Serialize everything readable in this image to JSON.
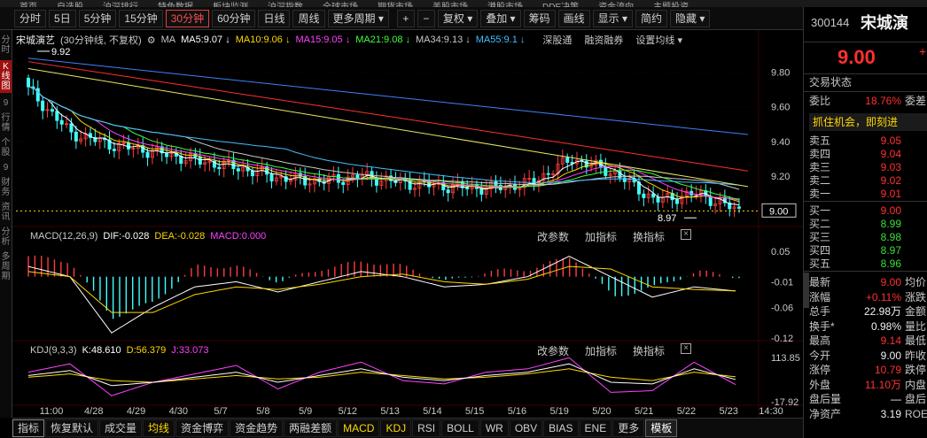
{
  "market_tabs": [
    "首页",
    "自选股",
    "沪深排行",
    "特色数据",
    "板块监测",
    "沪深指数",
    "全球市场",
    "期货市场",
    "美股市场",
    "港股市场",
    "DDE决策",
    "资金流向",
    "主题投资"
  ],
  "toolbar": {
    "periods": [
      "分时",
      "5日",
      "5分钟",
      "15分钟",
      "30分钟",
      "60分钟",
      "日线",
      "周线",
      "更多周期 ▾"
    ],
    "active_period": "30分钟",
    "zoom_in": "+",
    "zoom_out": "−",
    "tools": [
      "复权 ▾",
      "叠加 ▾",
      "筹码",
      "画线",
      "显示 ▾",
      "简约",
      "隐藏 ▾"
    ]
  },
  "left_strip": [
    "分时",
    "K线图",
    "9",
    "行情",
    "个股",
    "9",
    "财务",
    "资讯",
    "分析",
    "多周期"
  ],
  "main_panel": {
    "stock_name": "宋城演艺",
    "period_label": "(30分钟线, 不复权)",
    "ma_label": "MA",
    "ma": [
      {
        "label": "MA5:9.07",
        "color": "#ffffff"
      },
      {
        "label": "MA10:9.06",
        "color": "#ffd700"
      },
      {
        "label": "MA15:9.05",
        "color": "#ff40ff"
      },
      {
        "label": "MA21:9.08",
        "color": "#40ff40"
      },
      {
        "label": "MA34:9.13",
        "color": "#c8c8c8"
      },
      {
        "label": "MA55:9.1",
        "color": "#40c0ff"
      }
    ],
    "extra_tabs": [
      "深股通",
      "融资融券",
      "设置均线 ▾"
    ],
    "y_ticks": [
      "9.80",
      "9.60",
      "9.40",
      "9.20",
      "9.00"
    ],
    "high_label": "9.92",
    "low_label": "8.97",
    "current_price_tag": "9.00"
  },
  "macd_panel": {
    "title": "MACD(12,26,9)",
    "dif": "DIF:-0.028",
    "dea": "DEA:-0.028",
    "macd": "MACD:0.000",
    "tools": [
      "改参数",
      "加指标",
      "换指标"
    ],
    "y_ticks": [
      "0.05",
      "-0.01",
      "-0.06",
      "-0.12"
    ]
  },
  "kdj_panel": {
    "title": "KDJ(9,3,3)",
    "k": "K:48.610",
    "d": "D:56.379",
    "j": "J:33.073",
    "tools": [
      "改参数",
      "加指标",
      "换指标"
    ],
    "y_ticks": [
      "113.85",
      "-17.92"
    ]
  },
  "x_axis": [
    "11:00",
    "4/28",
    "4/29",
    "4/30",
    "5/7",
    "5/8",
    "5/9",
    "5/12",
    "5/13",
    "5/14",
    "5/15",
    "5/16",
    "5/19",
    "5/20",
    "5/21",
    "5/22",
    "5/23",
    "14:30"
  ],
  "bottom_tabs": [
    "指标",
    "恢复默认",
    "成交量",
    "均线",
    "资金博弈",
    "资金趋势",
    "两融差额",
    "MACD",
    "KDJ",
    "RSI",
    "BOLL",
    "WR",
    "OBV",
    "BIAS",
    "ENE",
    "更多",
    "模板"
  ],
  "right_panel": {
    "code": "300144",
    "name": "宋城演",
    "price": "9.00",
    "trade_status_label": "交易状态",
    "wei_bi_label": "委比",
    "wei_bi_value": "18.76%",
    "wei_cha_label": "委差",
    "banner": "抓住机会，即刻进",
    "asks": [
      {
        "label": "卖五",
        "price": "9.05"
      },
      {
        "label": "卖四",
        "price": "9.04"
      },
      {
        "label": "卖三",
        "price": "9.03"
      },
      {
        "label": "卖二",
        "price": "9.02"
      },
      {
        "label": "卖一",
        "price": "9.01"
      }
    ],
    "bids": [
      {
        "label": "买一",
        "price": "9.00"
      },
      {
        "label": "买二",
        "price": "8.99"
      },
      {
        "label": "买三",
        "price": "8.98"
      },
      {
        "label": "买四",
        "price": "8.97"
      },
      {
        "label": "买五",
        "price": "8.96"
      }
    ],
    "stats": [
      {
        "label": "最新",
        "value": "9.00",
        "extra": "均价"
      },
      {
        "label": "涨幅",
        "value": "+0.11%",
        "extra": "涨跌"
      },
      {
        "label": "总手",
        "value": "22.98万",
        "extra": "金额"
      },
      {
        "label": "换手*",
        "value": "0.98%",
        "extra": "量比"
      },
      {
        "label": "最高",
        "value": "9.14",
        "extra": "最低"
      },
      {
        "label": "今开",
        "value": "9.00",
        "extra": "昨收"
      },
      {
        "label": "涨停",
        "value": "10.79",
        "extra": "跌停"
      },
      {
        "label": "外盘",
        "value": "11.10万",
        "extra": "内盘"
      },
      {
        "label": "盘后量",
        "value": "—",
        "extra": "盘后"
      },
      {
        "label": "净资产",
        "value": "3.19",
        "extra": "ROE"
      }
    ]
  },
  "chart_data": [
    {
      "type": "candlestick",
      "title": "宋城演艺 (30分钟线, 不复权)",
      "x": [
        "11:00",
        "4/28",
        "4/29",
        "4/30",
        "5/7",
        "5/8",
        "5/9",
        "5/12",
        "5/13",
        "5/14",
        "5/15",
        "5/16",
        "5/19",
        "5/20",
        "5/21",
        "5/22",
        "5/23",
        "14:30"
      ],
      "close": [
        9.7,
        9.45,
        9.38,
        9.34,
        9.29,
        9.25,
        9.19,
        9.17,
        9.2,
        9.16,
        9.14,
        9.13,
        9.16,
        9.3,
        9.22,
        9.06,
        9.1,
        9.0
      ],
      "ylim": [
        8.92,
        9.94
      ],
      "high": 9.92,
      "low": 8.97,
      "series": [
        {
          "name": "MA5",
          "value": 9.07
        },
        {
          "name": "MA10",
          "value": 9.06
        },
        {
          "name": "MA15",
          "value": 9.05
        },
        {
          "name": "MA21",
          "value": 9.08
        },
        {
          "name": "MA34",
          "value": 9.13
        },
        {
          "name": "MA55",
          "value": 9.1
        }
      ]
    },
    {
      "type": "bar",
      "title": "MACD(12,26,9)",
      "macd_hist": [
        0.04,
        0.03,
        -0.08,
        -0.05,
        0.02,
        0.02,
        -0.01,
        0.015,
        0.03,
        0.02,
        -0.01,
        0.01,
        0.015,
        0.04,
        -0.04,
        -0.02,
        0.01,
        0.0
      ],
      "dif": [
        0.02,
        0.0,
        -0.11,
        -0.06,
        -0.02,
        -0.01,
        -0.03,
        -0.01,
        0.01,
        0.0,
        -0.02,
        -0.015,
        0.0,
        0.04,
        0.0,
        -0.04,
        -0.02,
        -0.028
      ],
      "dea": [
        0.01,
        0.0,
        -0.07,
        -0.07,
        -0.035,
        -0.02,
        -0.025,
        -0.015,
        0.0,
        0.005,
        -0.01,
        -0.015,
        -0.005,
        0.02,
        0.015,
        -0.02,
        -0.025,
        -0.028
      ],
      "ylim": [
        -0.12,
        0.06
      ]
    },
    {
      "type": "line",
      "title": "KDJ(9,3,3)",
      "k": [
        60,
        75,
        30,
        40,
        55,
        70,
        40,
        60,
        80,
        55,
        45,
        60,
        70,
        95,
        40,
        35,
        80,
        48.61
      ],
      "d": [
        55,
        65,
        45,
        40,
        50,
        60,
        50,
        55,
        70,
        60,
        50,
        55,
        65,
        80,
        55,
        45,
        70,
        56.379
      ],
      "j": [
        70,
        95,
        0,
        40,
        65,
        90,
        20,
        70,
        100,
        45,
        35,
        70,
        80,
        113,
        10,
        15,
        100,
        33.073
      ],
      "ylim": [
        -17.92,
        113.85
      ]
    }
  ]
}
